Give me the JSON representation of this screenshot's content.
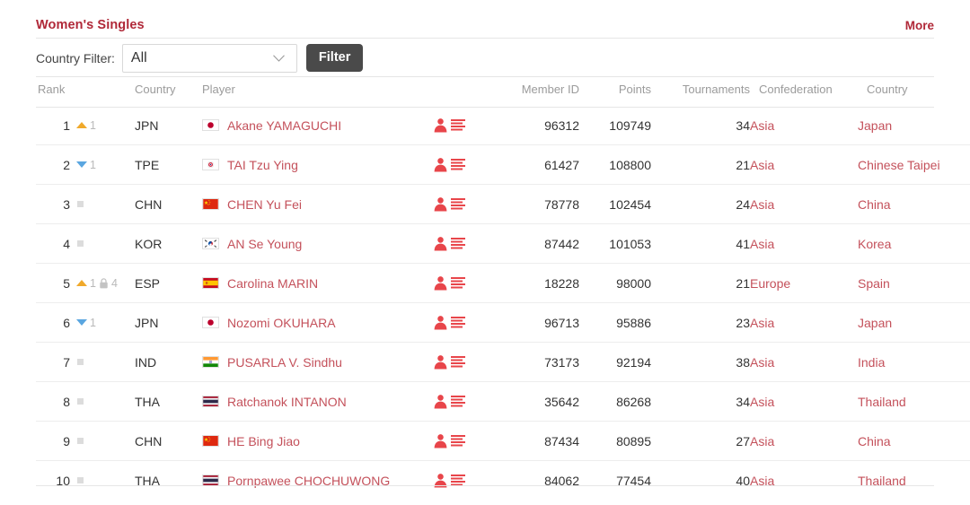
{
  "header": {
    "title": "Women's Singles",
    "more_label": "More"
  },
  "filter": {
    "label": "Country Filter:",
    "selected": "All",
    "options": [
      "All"
    ],
    "button_label": "Filter",
    "chevron_icon": "chevron-down-icon"
  },
  "table": {
    "columns": {
      "rank": "Rank",
      "country_code": "Country",
      "player": "Player",
      "member_id": "Member ID",
      "points": "Points",
      "tournaments": "Tournaments",
      "confederation": "Confederation",
      "country": "Country"
    },
    "rows": [
      {
        "rank": "1",
        "move_dir": "up",
        "move_value": "1",
        "locked": false,
        "locked_value": "",
        "country_code": "JPN",
        "flag": "flag-japan",
        "player": "Akane YAMAGUCHI",
        "member_id": "96312",
        "points": "109749",
        "tournaments": "34",
        "confederation": "Asia",
        "country": "Japan"
      },
      {
        "rank": "2",
        "move_dir": "down",
        "move_value": "1",
        "locked": false,
        "locked_value": "",
        "country_code": "TPE",
        "flag": "flag-chinese-taipei",
        "player": "TAI Tzu Ying",
        "member_id": "61427",
        "points": "108800",
        "tournaments": "21",
        "confederation": "Asia",
        "country": "Chinese Taipei"
      },
      {
        "rank": "3",
        "move_dir": "none",
        "move_value": "",
        "locked": false,
        "locked_value": "",
        "country_code": "CHN",
        "flag": "flag-china",
        "player": "CHEN Yu Fei",
        "member_id": "78778",
        "points": "102454",
        "tournaments": "24",
        "confederation": "Asia",
        "country": "China"
      },
      {
        "rank": "4",
        "move_dir": "none",
        "move_value": "",
        "locked": false,
        "locked_value": "",
        "country_code": "KOR",
        "flag": "flag-korea",
        "player": "AN Se Young",
        "member_id": "87442",
        "points": "101053",
        "tournaments": "41",
        "confederation": "Asia",
        "country": "Korea"
      },
      {
        "rank": "5",
        "move_dir": "up",
        "move_value": "1",
        "locked": true,
        "locked_value": "4",
        "country_code": "ESP",
        "flag": "flag-spain",
        "player": "Carolina MARIN",
        "member_id": "18228",
        "points": "98000",
        "tournaments": "21",
        "confederation": "Europe",
        "country": "Spain"
      },
      {
        "rank": "6",
        "move_dir": "down",
        "move_value": "1",
        "locked": false,
        "locked_value": "",
        "country_code": "JPN",
        "flag": "flag-japan",
        "player": "Nozomi OKUHARA",
        "member_id": "96713",
        "points": "95886",
        "tournaments": "23",
        "confederation": "Asia",
        "country": "Japan"
      },
      {
        "rank": "7",
        "move_dir": "none",
        "move_value": "",
        "locked": false,
        "locked_value": "",
        "country_code": "IND",
        "flag": "flag-india",
        "player": "PUSARLA V. Sindhu",
        "member_id": "73173",
        "points": "92194",
        "tournaments": "38",
        "confederation": "Asia",
        "country": "India"
      },
      {
        "rank": "8",
        "move_dir": "none",
        "move_value": "",
        "locked": false,
        "locked_value": "",
        "country_code": "THA",
        "flag": "flag-thailand",
        "player": "Ratchanok INTANON",
        "member_id": "35642",
        "points": "86268",
        "tournaments": "34",
        "confederation": "Asia",
        "country": "Thailand"
      },
      {
        "rank": "9",
        "move_dir": "none",
        "move_value": "",
        "locked": false,
        "locked_value": "",
        "country_code": "CHN",
        "flag": "flag-china",
        "player": "HE Bing Jiao",
        "member_id": "87434",
        "points": "80895",
        "tournaments": "27",
        "confederation": "Asia",
        "country": "China"
      },
      {
        "rank": "10",
        "move_dir": "none",
        "move_value": "",
        "locked": false,
        "locked_value": "",
        "country_code": "THA",
        "flag": "flag-thailand",
        "player": "Pornpawee CHOCHUWONG",
        "member_id": "84062",
        "points": "77454",
        "tournaments": "40",
        "confederation": "Asia",
        "country": "Thailand"
      }
    ],
    "row_icons": {
      "profile": "person-icon",
      "stats": "list-lines-icon"
    }
  },
  "colors": {
    "brand_red": "#b02838",
    "link_red": "#c4515b",
    "icon_red": "#e8454a",
    "arrow_up": "#f0a92b",
    "arrow_down": "#5aa6e0",
    "no_move": "#dcdcdc",
    "button_dark": "#4a4a4a"
  }
}
